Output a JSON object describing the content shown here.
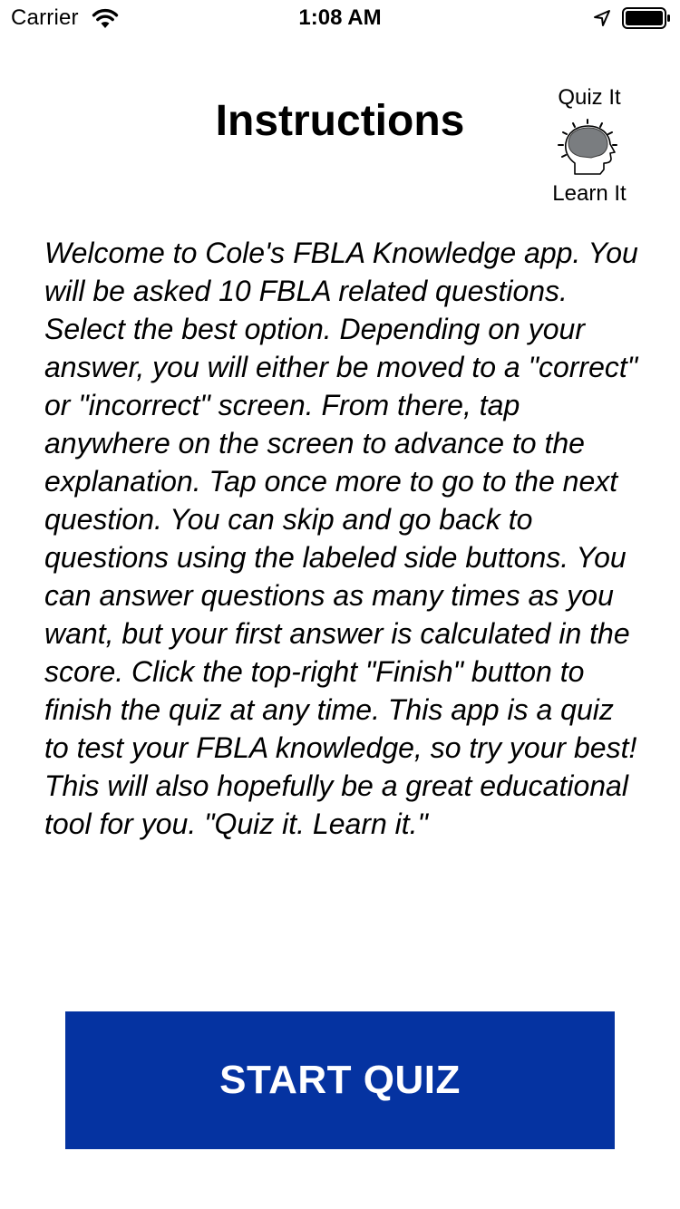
{
  "status_bar": {
    "carrier": "Carrier",
    "time": "1:08 AM",
    "icons": [
      "wifi-icon",
      "location-arrow-icon",
      "battery-icon"
    ]
  },
  "header": {
    "title": "Instructions",
    "logo": {
      "top_text": "Quiz It",
      "bottom_text": "Learn It",
      "icon": "brain-head-icon"
    }
  },
  "instructions": {
    "text": "Welcome to Cole's FBLA Knowledge app. You will be asked 10 FBLA related questions. Select the best option. Depending on your answer, you will either be moved to a \"correct\" or \"incorrect\" screen. From there, tap anywhere on the screen to advance to the explanation. Tap once more to go to the next question. You can skip and go back to questions using the labeled side buttons. You can answer questions as many times as you want, but your first answer is calculated in the score. Click the top-right \"Finish\" button to finish the quiz at any time. This app is a quiz to test your FBLA knowledge, so try your best! This will also hopefully be a great educational tool for you. \"Quiz it. Learn it.\""
  },
  "start_button": {
    "label": "START QUIZ",
    "color": "#0533a1"
  }
}
